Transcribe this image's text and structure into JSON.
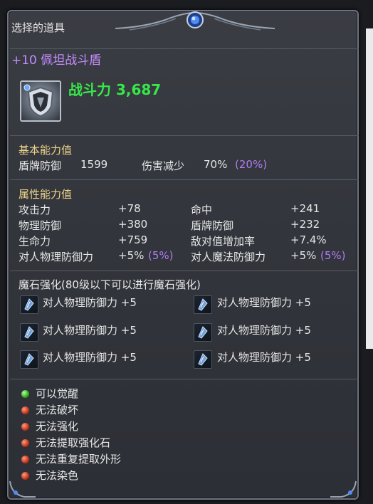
{
  "header": {
    "title": "选择的道具"
  },
  "item": {
    "name": "+10 佩坦战斗盾",
    "icon": "shield-item-icon",
    "power_label": "战斗力 3,687"
  },
  "basic": {
    "title": "基本能力值",
    "shield_def_label": "盾牌防御",
    "shield_def_value": "1599",
    "dmg_reduce_label": "伤害减少",
    "dmg_reduce_value": "70%",
    "dmg_reduce_bonus": "(20%)"
  },
  "attributes": {
    "title": "属性能力值",
    "rows": [
      {
        "l_label": "攻击力",
        "l_value": "+78",
        "r_label": "命中",
        "r_value": "+241"
      },
      {
        "l_label": "物理防御",
        "l_value": "+380",
        "r_label": "盾牌防御",
        "r_value": "+232"
      },
      {
        "l_label": "生命力",
        "l_value": "+759",
        "r_label": "敌对值增加率",
        "r_value": "+7.4%"
      },
      {
        "l_label": "对人物理防御力",
        "l_value": "+5%",
        "l_bonus": "(5%)",
        "r_label": "对人魔法防御力",
        "r_value": "+5%",
        "r_bonus": "(5%)"
      }
    ]
  },
  "manastones": {
    "title": "魔石强化(80级以下可以进行魔石强化)",
    "slots": [
      "对人物理防御力 +5",
      "对人物理防御力 +5",
      "对人物理防御力 +5",
      "对人物理防御力 +5",
      "对人物理防御力 +5",
      "对人物理防御力 +5"
    ]
  },
  "status": [
    {
      "text": "可以觉醒",
      "color": "green"
    },
    {
      "text": "无法破坏",
      "color": "red"
    },
    {
      "text": "无法强化",
      "color": "red"
    },
    {
      "text": "无法提取强化石",
      "color": "red"
    },
    {
      "text": "无法重复提取外形",
      "color": "red"
    },
    {
      "text": "无法染色",
      "color": "red"
    }
  ]
}
